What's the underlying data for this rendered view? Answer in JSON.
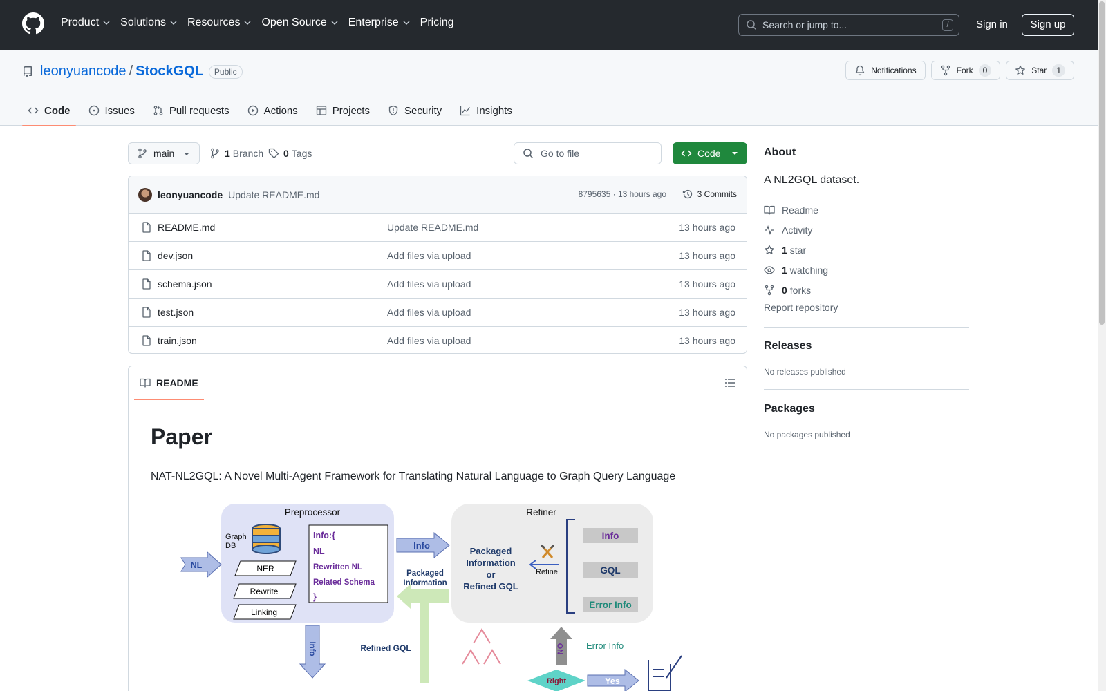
{
  "header": {
    "nav": [
      "Product",
      "Solutions",
      "Resources",
      "Open Source",
      "Enterprise",
      "Pricing"
    ],
    "search_placeholder": "Search or jump to...",
    "search_hotkey": "/",
    "sign_in": "Sign in",
    "sign_up": "Sign up"
  },
  "repo": {
    "owner": "leonyuancode",
    "separator": "/",
    "name": "StockGQL",
    "visibility": "Public",
    "notifications_label": "Notifications",
    "fork_label": "Fork",
    "fork_count": "0",
    "star_label": "Star",
    "star_count": "1"
  },
  "tabs": [
    "Code",
    "Issues",
    "Pull requests",
    "Actions",
    "Projects",
    "Security",
    "Insights"
  ],
  "toolbar": {
    "branch": "main",
    "branch_count": "1",
    "branch_label": "Branch",
    "tag_count": "0",
    "tag_label": "Tags",
    "go_to_file": "Go to file",
    "code_button": "Code"
  },
  "latest_commit": {
    "author": "leonyuancode",
    "message": "Update README.md",
    "sha_time": "8795635 · 13 hours ago",
    "commits_label": "3 Commits"
  },
  "files": [
    {
      "name": "README.md",
      "message": "Update README.md",
      "age": "13 hours ago"
    },
    {
      "name": "dev.json",
      "message": "Add files via upload",
      "age": "13 hours ago"
    },
    {
      "name": "schema.json",
      "message": "Add files via upload",
      "age": "13 hours ago"
    },
    {
      "name": "test.json",
      "message": "Add files via upload",
      "age": "13 hours ago"
    },
    {
      "name": "train.json",
      "message": "Add files via upload",
      "age": "13 hours ago"
    }
  ],
  "readme": {
    "tab_label": "README",
    "heading": "Paper",
    "paragraph": "NAT-NL2GQL: A Novel Multi-Agent Framework for Translating Natural Language to Graph Query Language",
    "figure": {
      "preprocessor_title": "Preprocessor",
      "graph_db": [
        "Graph",
        "DB"
      ],
      "nl_arrow": "NL",
      "steps": [
        "NER",
        "Rewrite",
        "Linking"
      ],
      "info_block": [
        "Info:{",
        "NL",
        "Rewritten NL",
        "Related Schema",
        "}"
      ],
      "info_arrow": "Info",
      "packaged_label": [
        "Packaged",
        "Information"
      ],
      "refiner_title": "Refiner",
      "refiner_text": [
        "Packaged",
        "Information",
        "or",
        "Refined GQL"
      ],
      "refine_label": "Refine",
      "refiner_boxes": [
        "Info",
        "GQL",
        "Error Info"
      ],
      "down_info": "Info",
      "refined_gql": "Refined GQL",
      "no_label": "NO",
      "error_info": "Error Info",
      "right_label": "Right",
      "yes_label": "Yes"
    }
  },
  "sidebar": {
    "about_title": "About",
    "description": "A NL2GQL dataset.",
    "readme": "Readme",
    "activity": "Activity",
    "stars_count": "1",
    "stars_label": "star",
    "watching_count": "1",
    "watching_label": "watching",
    "forks_count": "0",
    "forks_label": "forks",
    "report": "Report repository",
    "releases_title": "Releases",
    "releases_text": "No releases published",
    "packages_title": "Packages",
    "packages_text": "No packages published"
  }
}
